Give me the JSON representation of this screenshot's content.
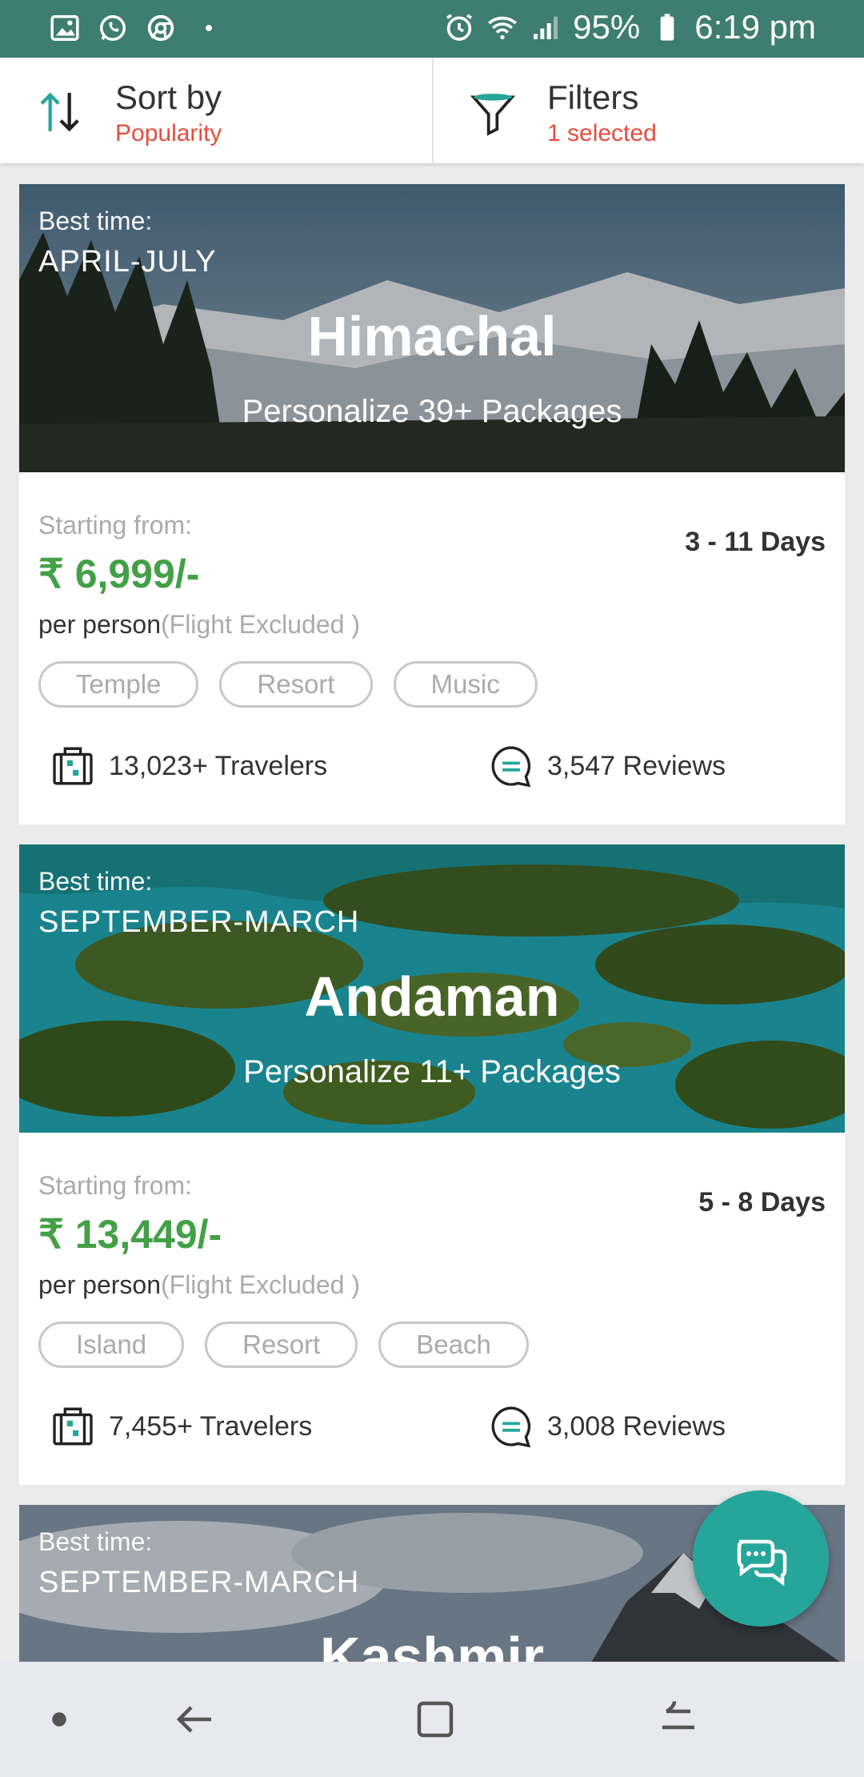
{
  "status_bar": {
    "battery": "95%",
    "time": "6:19 pm",
    "left_icons": [
      "gallery-icon",
      "whatsapp-icon",
      "chrome-icon",
      "dot-icon"
    ],
    "right_icons": [
      "alarm-icon",
      "wifi-icon",
      "signal-icon",
      "battery-icon"
    ]
  },
  "toolbar": {
    "sort_title": "Sort by",
    "sort_value": "Popularity",
    "filter_title": "Filters",
    "filter_value": "1 selected"
  },
  "cards": [
    {
      "best_label": "Best time:",
      "best_value": "APRIL-JULY",
      "name": "Himachal",
      "packages": "Personalize 39+ Packages",
      "start_label": "Starting from:",
      "price": "₹ 6,999/-",
      "per_person": "per person",
      "flight": "(Flight Excluded )",
      "days": "3 - 11 Days",
      "tags": [
        "Temple",
        "Resort",
        "Music"
      ],
      "travelers": "13,023+ Travelers",
      "reviews": "3,547 Reviews"
    },
    {
      "best_label": "Best time:",
      "best_value": "SEPTEMBER-MARCH",
      "name": "Andaman",
      "packages": "Personalize 11+ Packages",
      "start_label": "Starting from:",
      "price": "₹ 13,449/-",
      "per_person": "per person",
      "flight": "(Flight Excluded )",
      "days": "5 - 8 Days",
      "tags": [
        "Island",
        "Resort",
        "Beach"
      ],
      "travelers": "7,455+ Travelers",
      "reviews": "3,008 Reviews"
    },
    {
      "best_label": "Best time:",
      "best_value": "SEPTEMBER-MARCH",
      "name": "Kashmir"
    }
  ],
  "colors": {
    "status_bar": "#3e7d71",
    "accent_red": "#e74c3c",
    "price_green": "#43a047",
    "fab_teal": "#26a69a"
  },
  "nav_icons": [
    "dot-nav-icon",
    "back-icon",
    "home-icon",
    "recents-icon"
  ]
}
